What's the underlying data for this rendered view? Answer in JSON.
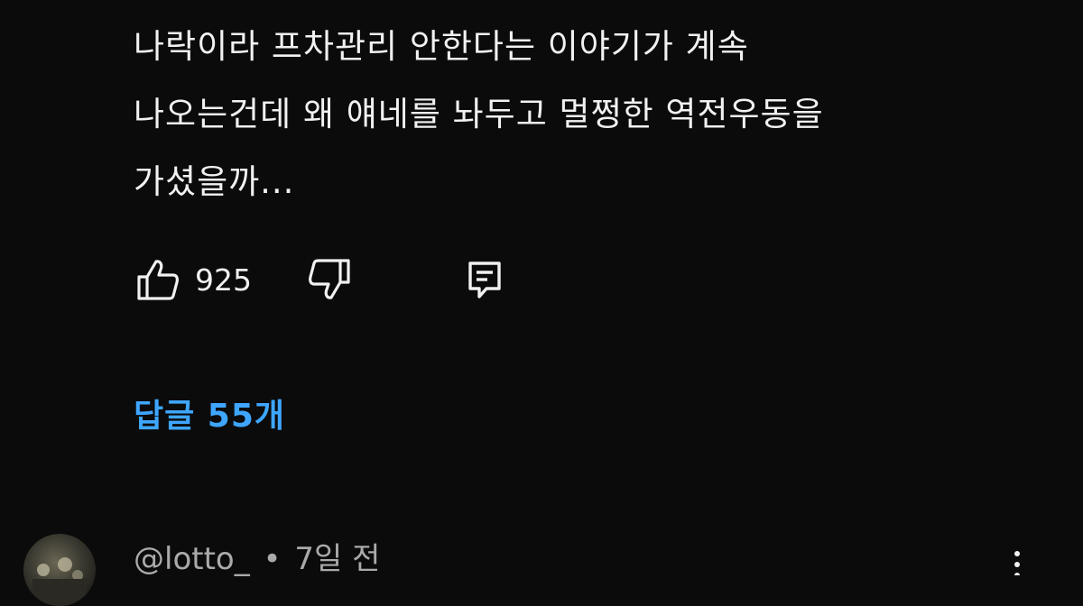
{
  "comment": {
    "text_lines": [
      "나락이라 프차관리 안한다는 이야기가 계속",
      "나오는건데 왜 얘네를 놔두고 멀쩡한 역전우동을",
      "가셨을까..."
    ],
    "like_count": "925"
  },
  "replies": {
    "toggle_label": "답글 55개"
  },
  "next_comment": {
    "author": "@lotto_",
    "separator": "•",
    "time": "7일 전"
  },
  "colors": {
    "background": "#0b0b0b",
    "text": "#f1f1f1",
    "link_accent": "#3ea6ff",
    "meta_text": "#aaaaaa"
  },
  "icons": {
    "like": "thumbs-up-icon",
    "dislike": "thumbs-down-icon",
    "reply": "reply-comment-icon",
    "more": "more-vertical-icon"
  }
}
